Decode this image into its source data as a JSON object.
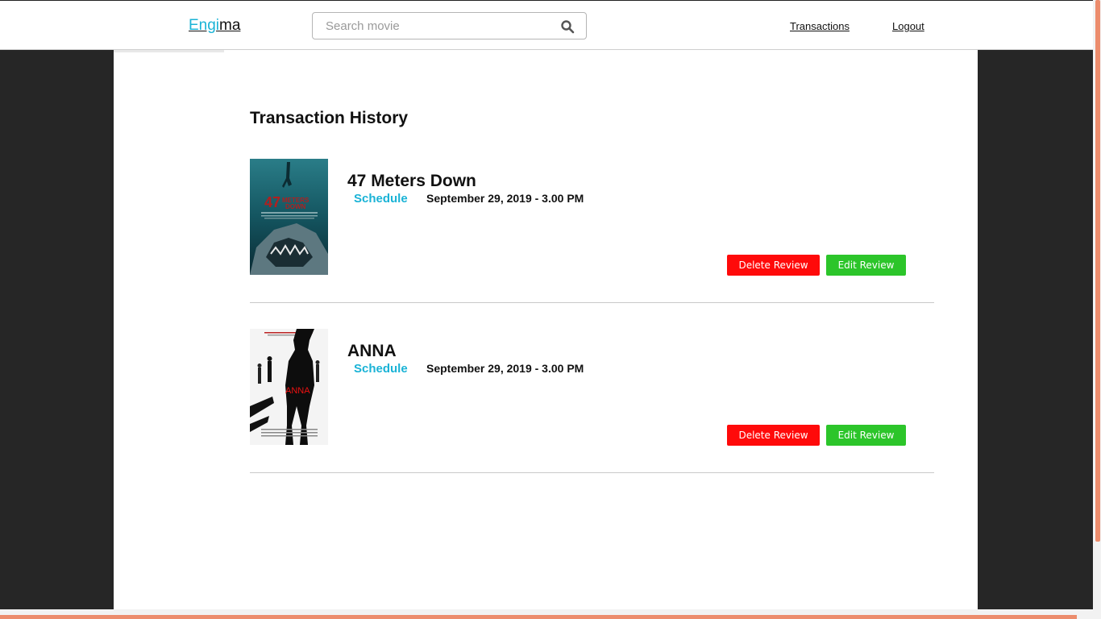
{
  "header": {
    "logo_accent": "Engi",
    "logo_rest": "ma",
    "search_placeholder": "Search movie",
    "nav": {
      "transactions": "Transactions",
      "logout": "Logout"
    }
  },
  "page": {
    "title": "Transaction History"
  },
  "transactions": [
    {
      "title": "47 Meters Down",
      "schedule_label": "Schedule",
      "schedule_time": "September 29, 2019 - 3.00 PM",
      "delete_label": "Delete Review",
      "edit_label": "Edit Review",
      "poster_text": "47 METERS DOWN"
    },
    {
      "title": "ANNA",
      "schedule_label": "Schedule",
      "schedule_time": "September 29, 2019 - 3.00 PM",
      "delete_label": "Delete Review",
      "edit_label": "Edit Review",
      "poster_text": "ANNA"
    }
  ],
  "colors": {
    "accent": "#1ab3d6",
    "delete": "#ff0a0a",
    "edit": "#2cc52a",
    "background": "#262626",
    "scrollbar": "#ec8c6c"
  },
  "icons": {
    "search": "search-icon"
  }
}
